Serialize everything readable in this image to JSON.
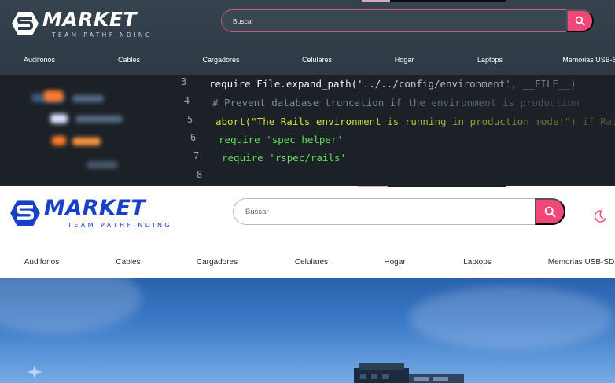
{
  "brand": {
    "name": "MARKET",
    "tagline": "TEAM PATHFINDING"
  },
  "search": {
    "placeholder": "Buscar"
  },
  "nav": {
    "dark": [
      "Audifonos",
      "Cables",
      "Cargadores",
      "Celulares",
      "Hogar",
      "Laptops",
      "Memorias USB-S"
    ],
    "light": [
      "Audifonos",
      "Cables",
      "Cargadores",
      "Celulares",
      "Hogar",
      "Laptops",
      "Memorias USB-SD"
    ]
  },
  "hero_code": {
    "line_numbers": [
      "3",
      "4",
      "5",
      "6",
      "7",
      "8"
    ],
    "lines": [
      "require File.expand_path('../../config/environment', __FILE__)",
      "# Prevent database truncation if the environment is production",
      "abort(\"The Rails environment is running in production mode!\") if Rails.env.production?",
      "require 'spec_helper'",
      "require 'rspec/rails'"
    ]
  },
  "colors": {
    "accent": "#f0467a",
    "dark_header": "#323e4a",
    "brand_blue": "#1840c8",
    "sky": "#3a78c6"
  },
  "icons": {
    "logo": "market-logo-icon",
    "search": "search-icon",
    "theme": "moon-icon"
  }
}
